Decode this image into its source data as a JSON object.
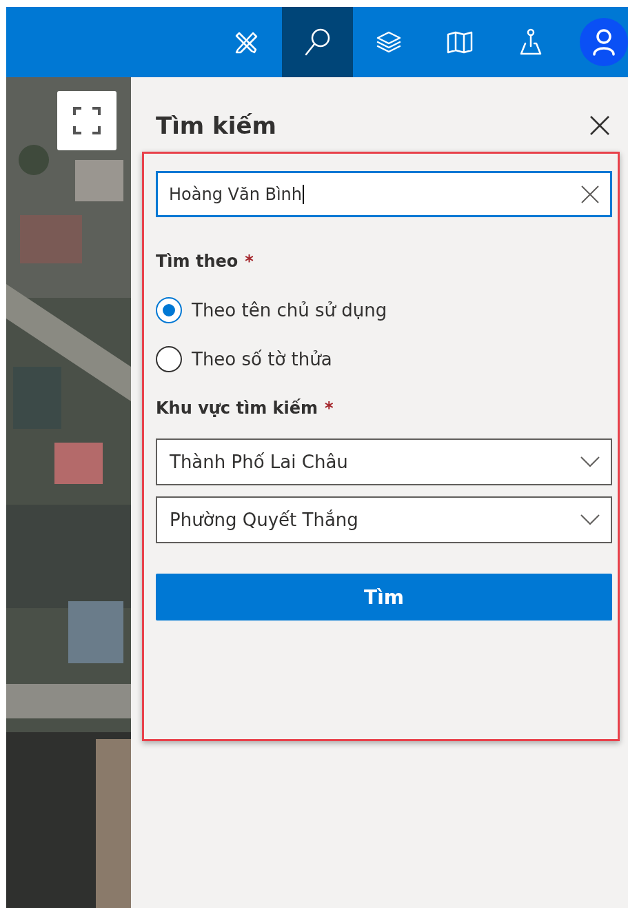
{
  "toolbar": {
    "buttons": [
      {
        "kind": "draw",
        "selected": false
      },
      {
        "kind": "search",
        "selected": true
      },
      {
        "kind": "layers",
        "selected": false
      },
      {
        "kind": "map",
        "selected": false
      },
      {
        "kind": "locate",
        "selected": false
      },
      {
        "kind": "user",
        "selected": false
      }
    ]
  },
  "panel": {
    "title": "Tìm kiếm",
    "search": {
      "value": "Hoàng Văn Bình"
    },
    "search_by": {
      "label": "Tìm theo",
      "marker": "*",
      "options": [
        {
          "label": "Theo tên chủ sử dụng",
          "selected": true
        },
        {
          "label": "Theo số tờ thửa",
          "selected": false
        }
      ]
    },
    "area": {
      "label": "Khu vực tìm kiếm",
      "marker": "*",
      "dropdowns": [
        {
          "value": "Thành Phố Lai Châu"
        },
        {
          "value": "Phường Quyết Thắng"
        }
      ]
    },
    "submit": "Tìm"
  }
}
